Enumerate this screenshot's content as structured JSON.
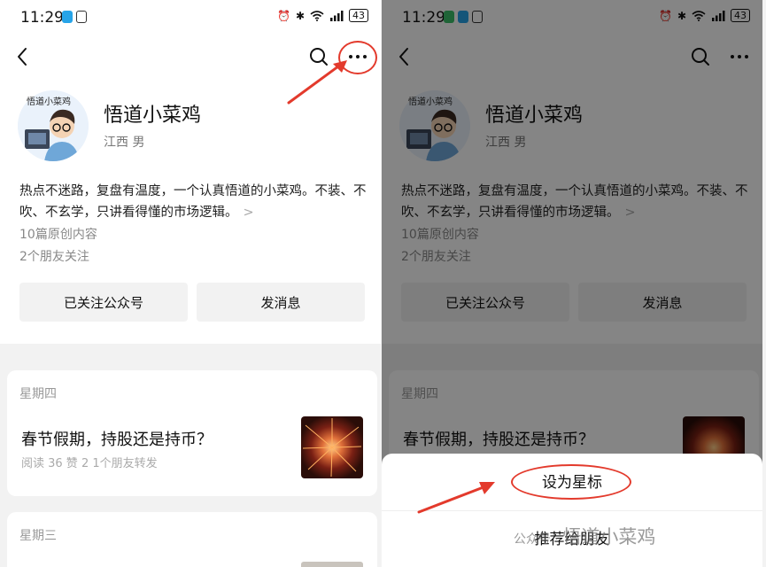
{
  "status": {
    "time": "11:29",
    "battery": "43"
  },
  "profile": {
    "avatar_caption": "悟道小菜鸡",
    "name": "悟道小菜鸡",
    "meta": "江西 男",
    "description": "热点不迷路，复盘有温度，一个认真悟道的小菜鸡。不装、不吹、不玄学，只讲看得懂的市场逻辑。",
    "desc_chevron": ">",
    "original_count": "10篇原创内容",
    "friends_follow": "2个朋友关注"
  },
  "buttons": {
    "followed": "已关注公众号",
    "message": "发消息"
  },
  "articles": [
    {
      "day": "星期四",
      "title": "春节假期，持股还是持币？",
      "stats": "阅读 36  赞 2  1个朋友转发"
    },
    {
      "day": "星期三"
    }
  ],
  "sheet": {
    "star": "设为星标",
    "recommend": "推荐给朋友"
  },
  "watermark": {
    "prefix": "公众号 · ",
    "text": "悟道小菜鸡"
  },
  "icons": [
    "back-icon",
    "search-icon",
    "more-icon",
    "wifi-icon",
    "signal-icon",
    "battery-icon"
  ],
  "colors": {
    "annotation": "#e33a2c",
    "card_bg": "#ffffff",
    "page_bg": "#f2f2f2"
  }
}
